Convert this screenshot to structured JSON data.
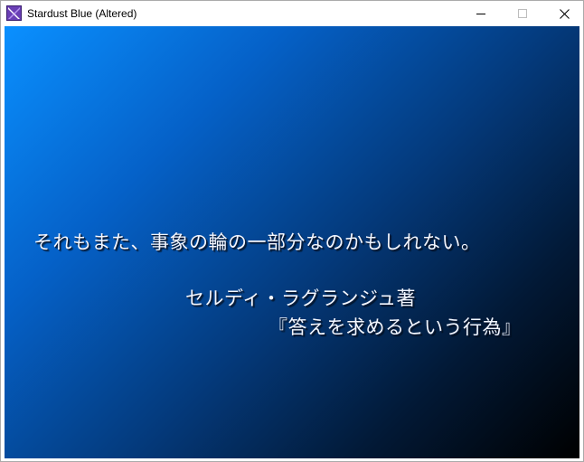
{
  "window": {
    "title": "Stardust Blue (Altered)"
  },
  "controls": {
    "minimize_icon": "minimize-icon",
    "maximize_icon": "maximize-icon",
    "close_icon": "close-icon"
  },
  "message": {
    "line1": "それもまた、事象の輪の一部分なのかもしれない。",
    "line2": "セルディ・ラグランジュ著",
    "line3": "『答えを求めるという行為』"
  },
  "colors": {
    "gradient_top_left": "#0a90ff",
    "gradient_bottom_right": "#000000",
    "text": "#f2f6ff"
  }
}
